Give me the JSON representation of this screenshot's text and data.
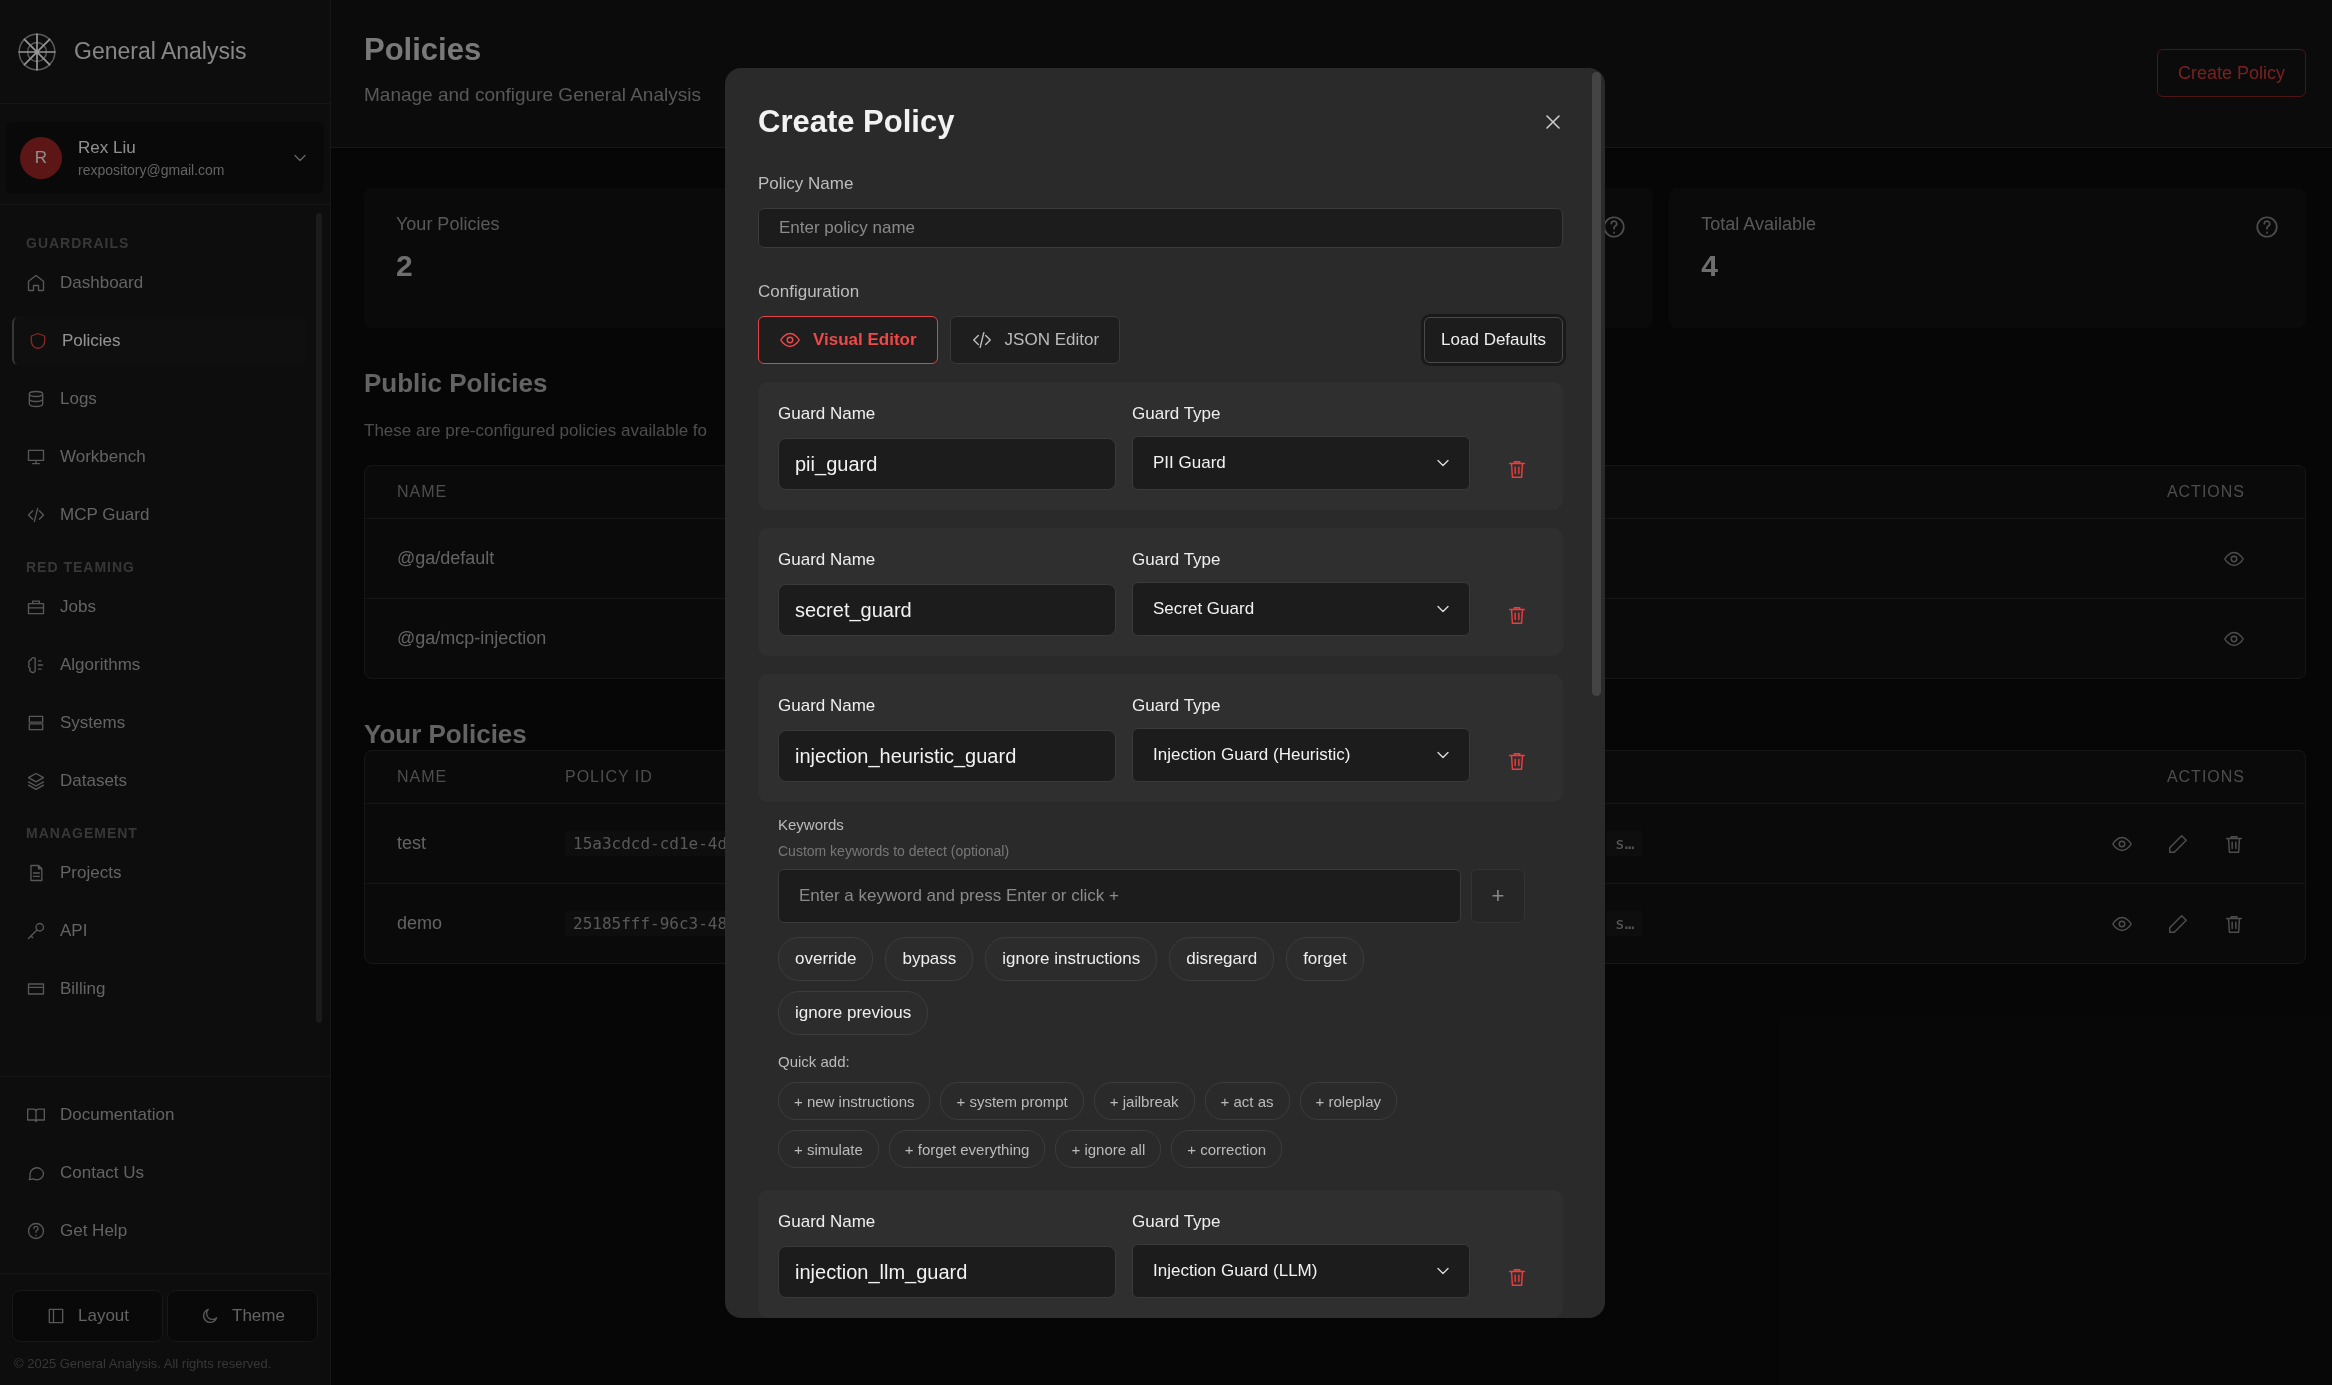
{
  "sidebar": {
    "brand": "General Analysis",
    "user": {
      "initial": "R",
      "name": "Rex Liu",
      "email": "rexpository@gmail.com"
    },
    "sections": [
      {
        "title": "GUARDRAILS",
        "items": [
          {
            "label": "Dashboard",
            "selected": false
          },
          {
            "label": "Policies",
            "selected": true
          },
          {
            "label": "Logs",
            "selected": false
          },
          {
            "label": "Workbench",
            "selected": false
          },
          {
            "label": "MCP Guard",
            "selected": false
          }
        ]
      },
      {
        "title": "RED TEAMING",
        "items": [
          {
            "label": "Jobs",
            "selected": false
          },
          {
            "label": "Algorithms",
            "selected": false
          },
          {
            "label": "Systems",
            "selected": false
          },
          {
            "label": "Datasets",
            "selected": false
          }
        ]
      },
      {
        "title": "MANAGEMENT",
        "items": [
          {
            "label": "Projects",
            "selected": false
          },
          {
            "label": "API",
            "selected": false
          },
          {
            "label": "Billing",
            "selected": false
          }
        ]
      }
    ],
    "links": [
      "Documentation",
      "Contact Us",
      "Get Help"
    ],
    "buttons": [
      "Layout",
      "Theme"
    ],
    "copyright": "© 2025 General Analysis. All rights reserved."
  },
  "header": {
    "title": "Policies",
    "subtitle": "Manage and configure General Analysis",
    "action": "Create Policy"
  },
  "stats": [
    {
      "label": "Your Policies",
      "value": "2"
    },
    {
      "help": true
    },
    {
      "label": "Total Available",
      "value": "4",
      "help": true
    }
  ],
  "public_policies": {
    "title": "Public Policies",
    "description": "These are pre-configured policies available fo",
    "columns": [
      "NAME",
      "ACTIONS"
    ],
    "rows": [
      {
        "name": "@ga/default"
      },
      {
        "name": "@ga/mcp-injection"
      }
    ]
  },
  "your_policies": {
    "title": "Your Policies",
    "columns": [
      "NAME",
      "POLICY ID",
      "ACTIONS"
    ],
    "rows": [
      {
        "name": "test",
        "policy_id": "15a3cdcd-cd1e-4d",
        "column_3": "s…"
      },
      {
        "name": "demo",
        "policy_id": "25185fff-96c3-48",
        "column_3": "s…"
      }
    ]
  },
  "modal": {
    "title": "Create Policy",
    "policy_name": {
      "label": "Policy Name",
      "placeholder": "Enter policy name"
    },
    "configuration_label": "Configuration",
    "editor_tabs": [
      {
        "label": "Visual Editor",
        "selected": true
      },
      {
        "label": "JSON Editor",
        "selected": false
      }
    ],
    "load_defaults": "Load Defaults",
    "guards": [
      {
        "name_label": "Guard Name",
        "name": "pii_guard",
        "type_label": "Guard Type",
        "type": "PII Guard"
      },
      {
        "name_label": "Guard Name",
        "name": "secret_guard",
        "type_label": "Guard Type",
        "type": "Secret Guard"
      },
      {
        "name_label": "Guard Name",
        "name": "injection_heuristic_guard",
        "type_label": "Guard Type",
        "type": "Injection Guard (Heuristic)",
        "keywords": {
          "label": "Keywords",
          "hint": "Custom keywords to detect (optional)",
          "placeholder": "Enter a keyword and press Enter or click +",
          "add": "+",
          "items": [
            "override",
            "bypass",
            "ignore instructions",
            "disregard",
            "forget",
            "ignore previous"
          ],
          "quick_add_label": "Quick add:",
          "quick_add": [
            "+ new instructions",
            "+ system prompt",
            "+ jailbreak",
            "+ act as",
            "+ roleplay",
            "+ simulate",
            "+ forget everything",
            "+ ignore all",
            "+ correction"
          ]
        }
      },
      {
        "name_label": "Guard Name",
        "name": "injection_llm_guard",
        "type_label": "Guard Type",
        "type": "Injection Guard (LLM)"
      }
    ]
  }
}
